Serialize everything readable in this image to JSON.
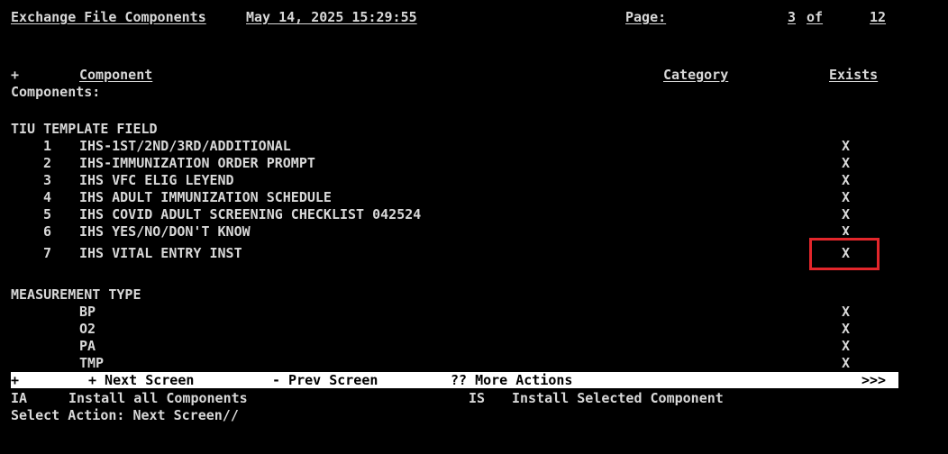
{
  "header": {
    "title": "Exchange File Components",
    "datetime": "May 14, 2025 15:29:55",
    "page_label": "Page:",
    "page_current": "3",
    "page_of": "of",
    "page_total": "12"
  },
  "columns": {
    "plus": "+",
    "component": "Component",
    "category": "Category",
    "exists": "Exists"
  },
  "section_label": "Components:",
  "groups": [
    {
      "name": "TIU TEMPLATE FIELD",
      "rows": [
        {
          "num": "1",
          "name": "IHS-1ST/2ND/3RD/ADDITIONAL",
          "exists": "X"
        },
        {
          "num": "2",
          "name": "IHS-IMMUNIZATION ORDER PROMPT",
          "exists": "X"
        },
        {
          "num": "3",
          "name": "IHS VFC ELIG LEYEND",
          "exists": "X"
        },
        {
          "num": "4",
          "name": "IHS ADULT IMMUNIZATION SCHEDULE",
          "exists": "X"
        },
        {
          "num": "5",
          "name": "IHS COVID ADULT SCREENING CHECKLIST 042524",
          "exists": "X"
        },
        {
          "num": "6",
          "name": "IHS YES/NO/DON'T KNOW",
          "exists": "X"
        },
        {
          "num": "7",
          "name": "IHS VITAL ENTRY INST",
          "exists": "X"
        }
      ]
    },
    {
      "name": "MEASUREMENT TYPE",
      "rows": [
        {
          "num": "",
          "name": "BP",
          "exists": "X"
        },
        {
          "num": "",
          "name": "O2",
          "exists": "X"
        },
        {
          "num": "",
          "name": "PA",
          "exists": "X"
        },
        {
          "num": "",
          "name": "TMP",
          "exists": "X"
        }
      ]
    }
  ],
  "nav_bar": {
    "plus": "+",
    "next": "+ Next Screen",
    "prev": "- Prev Screen",
    "more": "?? More Actions",
    "arrows": ">>>"
  },
  "actions": [
    {
      "code": "IA",
      "label": "Install all Components"
    },
    {
      "code": "IS",
      "label": "Install Selected Component"
    }
  ],
  "prompt": "Select Action: Next Screen//",
  "colors": {
    "highlight_box": "#e3262b",
    "text": "#d8d8d8",
    "background": "#000000"
  }
}
